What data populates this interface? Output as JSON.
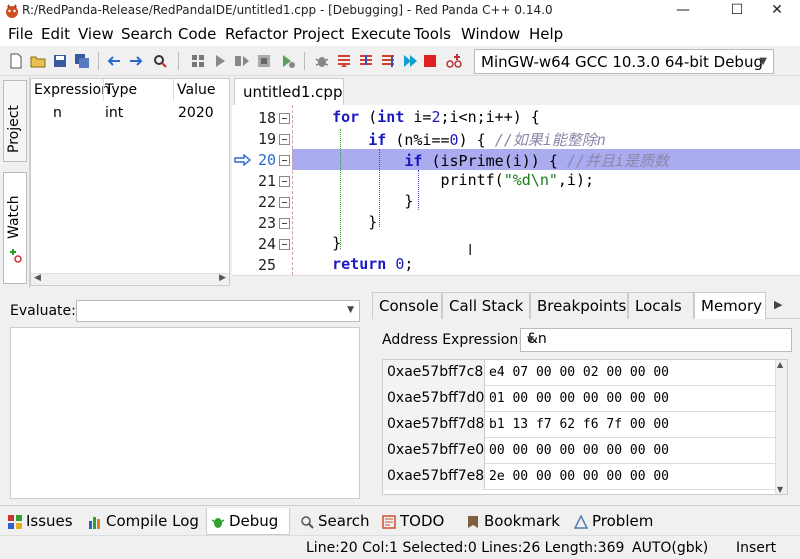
{
  "window": {
    "title": "R:/RedPanda-Release/RedPandaIDE/untitled1.cpp - [Debugging] - Red Panda C++ 0.14.0",
    "minimize": "—",
    "maximize": "☐",
    "close": "✕"
  },
  "menu": [
    "File",
    "Edit",
    "View",
    "Search",
    "Code",
    "Refactor",
    "Project",
    "Execute",
    "Tools",
    "Window",
    "Help"
  ],
  "toolbar": {
    "compiler": "MinGW-w64 GCC 10.3.0 64-bit Debug"
  },
  "left_tabs": [
    "Project",
    "Watch"
  ],
  "watch": {
    "headers": [
      "Expression",
      "Type",
      "Value"
    ],
    "rows": [
      {
        "expression": "n",
        "type": "int",
        "value": "2020"
      }
    ]
  },
  "editor": {
    "tab": "untitled1.cpp",
    "current_line": "20",
    "lines": [
      {
        "num": "18",
        "code": "    for (int i=2;i<n;i++) {"
      },
      {
        "num": "19",
        "code": "        if (n%i==0) { //如果i能整除n"
      },
      {
        "num": "20",
        "code": "            if (isPrime(i)) { //并且i是质数"
      },
      {
        "num": "21",
        "code": "                printf(\"%d\\n\",i);"
      },
      {
        "num": "22",
        "code": "            }"
      },
      {
        "num": "23",
        "code": "        }"
      },
      {
        "num": "24",
        "code": "    }"
      },
      {
        "num": "25",
        "code": "    return 0;"
      }
    ]
  },
  "evaluate": {
    "label": "Evaluate:",
    "value": ""
  },
  "debug_tabs": [
    "Console",
    "Call Stack",
    "Breakpoints",
    "Locals",
    "Memory"
  ],
  "memory": {
    "address_label": "Address Expression:",
    "address_value": "&n",
    "rows": [
      {
        "addr": "0xae57bff7c8",
        "bytes": "e4 07 00 00 02 00 00 00"
      },
      {
        "addr": "0xae57bff7d0",
        "bytes": "01 00 00 00 00 00 00 00"
      },
      {
        "addr": "0xae57bff7d8",
        "bytes": "b1 13 f7 62 f6 7f 00 00"
      },
      {
        "addr": "0xae57bff7e0",
        "bytes": "00 00 00 00 00 00 00 00"
      },
      {
        "addr": "0xae57bff7e8",
        "bytes": "2e 00 00 00 00 00 00 00"
      }
    ]
  },
  "bottom_tabs": [
    "Issues",
    "Compile Log",
    "Debug",
    "Search",
    "TODO",
    "Bookmark",
    "Problem"
  ],
  "status": {
    "position": "Line:20 Col:1 Selected:0 Lines:26 Length:369",
    "encoding": "AUTO(gbk)",
    "mode": "Insert"
  },
  "colors": {
    "accent": "#ababf0",
    "keyword": "#1a1ac0",
    "comment": "#8888aa"
  }
}
